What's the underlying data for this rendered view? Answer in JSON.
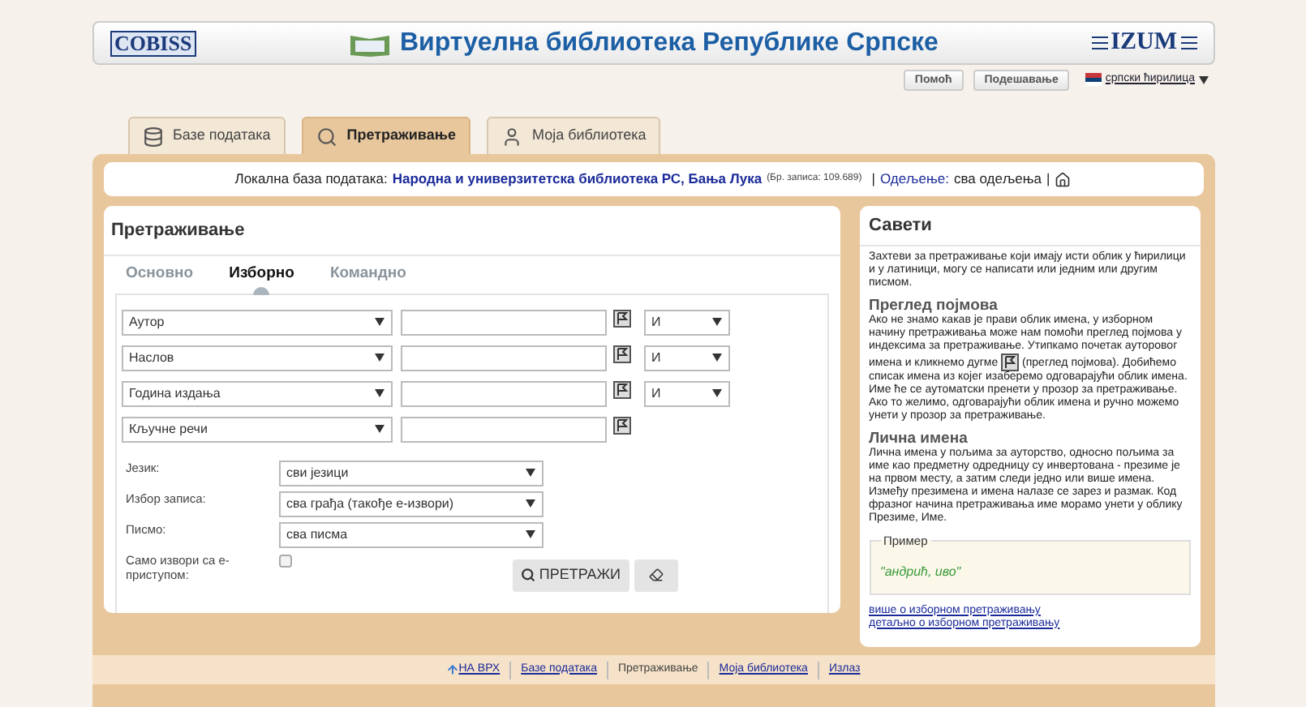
{
  "header": {
    "logo_left": "COBISS",
    "title": "Виртуелна библиотека Републике Српске",
    "logo_right": "IZUM"
  },
  "top_buttons": [
    "Помоћ",
    "Подешавање"
  ],
  "language": {
    "label": "српски ћирилица"
  },
  "tabs": [
    {
      "label": "Базе података",
      "selected": false
    },
    {
      "label": "Претраживање",
      "selected": true
    },
    {
      "label": "Моја библиотека",
      "selected": false
    }
  ],
  "info_bar": {
    "label": "Локална база података:",
    "library": "Народна и универзитетска библиотека РС, Бања Лука",
    "record_count": "(Бр. записа: 109.689)",
    "separator": "|",
    "department_label": "Одељење:",
    "department": "сва одељења",
    "separator_2": "|"
  },
  "search": {
    "title": "Претраживање",
    "subtabs": [
      {
        "label": "Основно",
        "selected": false
      },
      {
        "label": "Изборно",
        "selected": true
      },
      {
        "label": "Командно",
        "selected": false
      }
    ],
    "rows": [
      {
        "field": "Аутор",
        "operator": "И"
      },
      {
        "field": "Наслов",
        "operator": "И"
      },
      {
        "field": "Година издања",
        "operator": "И"
      },
      {
        "field": "Кључне речи"
      }
    ],
    "filters": [
      {
        "kind": "select",
        "label": "Језик:",
        "value": "сви језици"
      },
      {
        "kind": "select",
        "label": "Избор записа:",
        "value": "сва грађа (такође е-извори)"
      },
      {
        "kind": "select",
        "label": "Писмо:",
        "value": "сва писма"
      },
      {
        "kind": "checkbox",
        "label": "Само извори са е-приступом:",
        "checked": false
      }
    ],
    "search_button": "ПРЕТРАЖИ"
  },
  "tips": {
    "title": "Савети",
    "intro": "Захтеви за претраживање који имају исти облик у ћирилици и у латиници, могу се написати или једним или другим писмом.",
    "sections": [
      {
        "heading": "Преглед појмова",
        "text_before": "Ако не знамо какав је прави облик имена, у изборном начину претраживања може нам помоћи преглед појмова у индексима за претраживање. Утипкамо почетак ауторовог имена и кликнемо дугме",
        "text_after": "(преглед појмова). Добићемо списак имена из којег изаберемо одговарајући облик имена. Име ће се аутоматски пренети у прозор за претраживање. Ако то желимо, одговарајући облик имена и ручно можемо унети у прозор за претраживање."
      },
      {
        "heading": "Лична имена",
        "text_before": "Лична имена у пољима за ауторство, односно пољима за име као предметну одредницу су инвертована - презиме је на првом месту, а затим следи једно или више имена. Између презимена и имена налазе се зарез и размак. Код фразног начина претраживања име морамо унети у облику Презиме, Име."
      }
    ],
    "example": {
      "legend": "Пример",
      "value": "\"андрић, иво\""
    },
    "links": [
      "више о изборном претраживању",
      "детаљно о изборном претраживању"
    ]
  },
  "footer": [
    {
      "label": "НА ВРХ",
      "kind": "top"
    },
    {
      "label": "Базе података",
      "kind": "link"
    },
    {
      "label": "Претраживање",
      "kind": "current"
    },
    {
      "label": "Моја библиотека",
      "kind": "link"
    },
    {
      "label": "Излаз",
      "kind": "link"
    }
  ]
}
